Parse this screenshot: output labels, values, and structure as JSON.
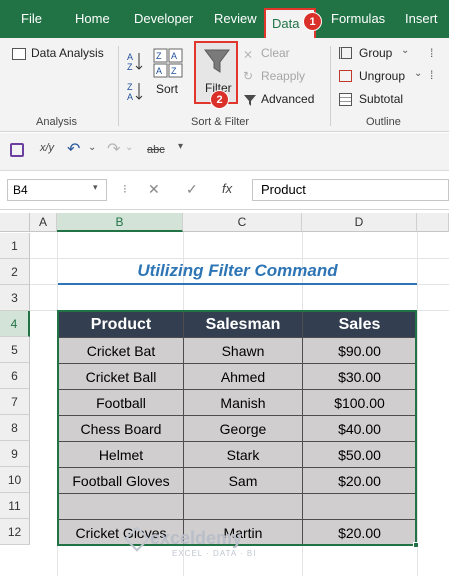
{
  "tabs": [
    "File",
    "Home",
    "Developer",
    "Review",
    "Data",
    "Formulas",
    "Insert"
  ],
  "ribbon": {
    "data_analysis": "Data Analysis",
    "analysis_group": "Analysis",
    "sort": "Sort",
    "filter": "Filter",
    "clear": "Clear",
    "reapply": "Reapply",
    "advanced": "Advanced",
    "sort_filter_group": "Sort & Filter",
    "group": "Group",
    "ungroup": "Ungroup",
    "subtotal": "Subtotal",
    "outline_group": "Outline",
    "az": "A↓Z",
    "za": "Z↓A",
    "zaz_top": "Z A",
    "zaz_bottom": "A Z"
  },
  "badges": {
    "one": "1",
    "two": "2"
  },
  "qat": {
    "strike": "abc"
  },
  "formula_bar": {
    "name_box": "B4",
    "fx": "fx",
    "content": "Product"
  },
  "columns": [
    "A",
    "B",
    "C",
    "D"
  ],
  "rows": [
    "1",
    "2",
    "3",
    "4",
    "5",
    "6",
    "7",
    "8",
    "9",
    "10",
    "11",
    "12"
  ],
  "sheet_title": "Utilizing Filter Command",
  "table": {
    "headers": [
      "Product",
      "Salesman",
      "Sales"
    ],
    "rows": [
      [
        "Cricket Bat",
        "Shawn",
        "$90.00"
      ],
      [
        "Cricket Ball",
        "Ahmed",
        "$30.00"
      ],
      [
        "Football",
        "Manish",
        "$100.00"
      ],
      [
        "Chess Board",
        "George",
        "$40.00"
      ],
      [
        "Helmet",
        "Stark",
        "$50.00"
      ],
      [
        "Football Gloves",
        "Sam",
        "$20.00"
      ],
      [
        "",
        "",
        ""
      ],
      [
        "Cricket Gloves",
        "Martin",
        "$20.00"
      ]
    ]
  },
  "watermark": {
    "name": "exceldemy",
    "tagline": "EXCEL · DATA · BI"
  },
  "colors": {
    "excel_green": "#217346",
    "highlight_red": "#e0362c",
    "header_dark": "#333f50",
    "cell_gray": "#d0cece",
    "title_blue": "#2e75b6"
  }
}
